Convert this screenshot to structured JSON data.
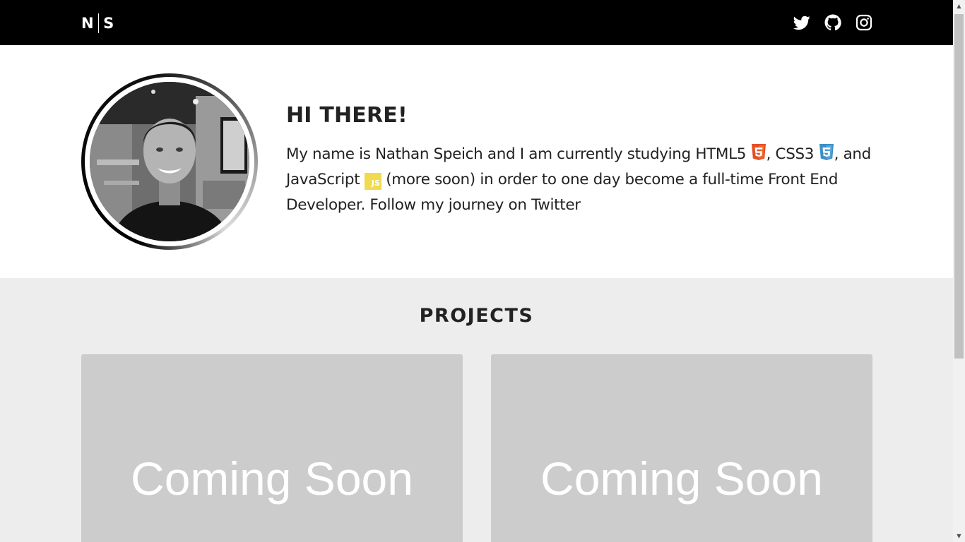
{
  "header": {
    "logo_left": "N",
    "logo_right": "S",
    "social_icons": [
      "twitter-icon",
      "github-icon",
      "instagram-icon"
    ]
  },
  "hero": {
    "greeting": "HI THERE!",
    "bio": {
      "part1": "My name is Nathan Speich and I am currently studying HTML5 ",
      "part2": ", CSS3 ",
      "part3": ", and JavaScript ",
      "part4": " (more soon) in order to one day become a full-time Front End Developer. Follow my journey on Twitter"
    },
    "js_badge": "JS"
  },
  "projects": {
    "title": "PROJECTS",
    "cards": [
      {
        "label": "Coming Soon"
      },
      {
        "label": "Coming Soon"
      }
    ]
  },
  "colors": {
    "nav_bg": "#000000",
    "html5": "#e34f26",
    "css3": "#2965f1",
    "js": "#f0db4f",
    "card_bg": "#cccccc"
  }
}
